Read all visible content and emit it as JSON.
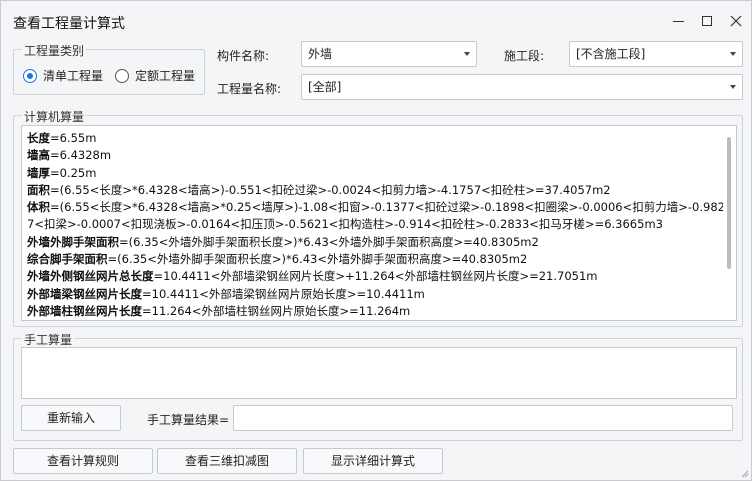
{
  "window": {
    "title": "查看工程量计算式"
  },
  "quantity_type": {
    "group_title": "工程量类别",
    "options": [
      {
        "label": "清单工程量",
        "selected": true
      },
      {
        "label": "定额工程量",
        "selected": false
      }
    ]
  },
  "filters": {
    "component_label": "构件名称:",
    "component_value": "外墙",
    "section_label": "施工段:",
    "section_value": "[不含施工段]",
    "quantity_name_label": "工程量名称:",
    "quantity_name_value": "[全部]"
  },
  "computer_calc": {
    "group_title": "计算机算量",
    "lines": [
      {
        "key": "长度",
        "expr": "=6.55m"
      },
      {
        "key": "墙高",
        "expr": "=6.4328m"
      },
      {
        "key": "墙厚",
        "expr": "=0.25m"
      },
      {
        "key": "面积",
        "expr": "=(6.55<长度>*6.4328<墙高>)-0.551<扣砼过梁>-0.0024<扣剪力墙>-4.1757<扣砼柱>=37.4057m2"
      },
      {
        "key": "体积",
        "expr": "=(6.55<长度>*6.4328<墙高>*0.25<墙厚>)-1.08<扣窗>-0.1377<扣砼过梁>-0.1898<扣圈梁>-0.0006<扣剪力墙>-0.982"
      },
      {
        "key": "",
        "expr": "7<扣梁>-0.0007<扣现浇板>-0.0164<扣压顶>-0.5621<扣构造柱>-0.914<扣砼柱>-0.2833<扣马牙槎>=6.3665m3"
      },
      {
        "key": "外墙外脚手架面积",
        "expr": "=(6.35<外墙外脚手架面积长度>)*6.43<外墙外脚手架面积高度>=40.8305m2"
      },
      {
        "key": "综合脚手架面积",
        "expr": "=(6.35<外墙外脚手架面积长度>)*6.43<外墙外脚手架面积高度>=40.8305m2"
      },
      {
        "key": "外墙外侧钢丝网片总长度",
        "expr": "=10.4411<外部墙梁钢丝网片长度>+11.264<外部墙柱钢丝网片长度>=21.7051m"
      },
      {
        "key": "外部墙梁钢丝网片长度",
        "expr": "=10.4411<外部墙梁钢丝网片原始长度>=10.4411m"
      },
      {
        "key": "外部墙柱钢丝网片长度",
        "expr": "=11.264<外部墙柱钢丝网片原始长度>=11.264m"
      }
    ]
  },
  "manual_calc": {
    "group_title": "手工算量",
    "reenter_label": "重新输入",
    "result_label": "手工算量结果=",
    "result_value": ""
  },
  "footer": {
    "rules_label": "查看计算规则",
    "view3d_label": "查看三维扣减图",
    "detail_label": "显示详细计算式"
  }
}
